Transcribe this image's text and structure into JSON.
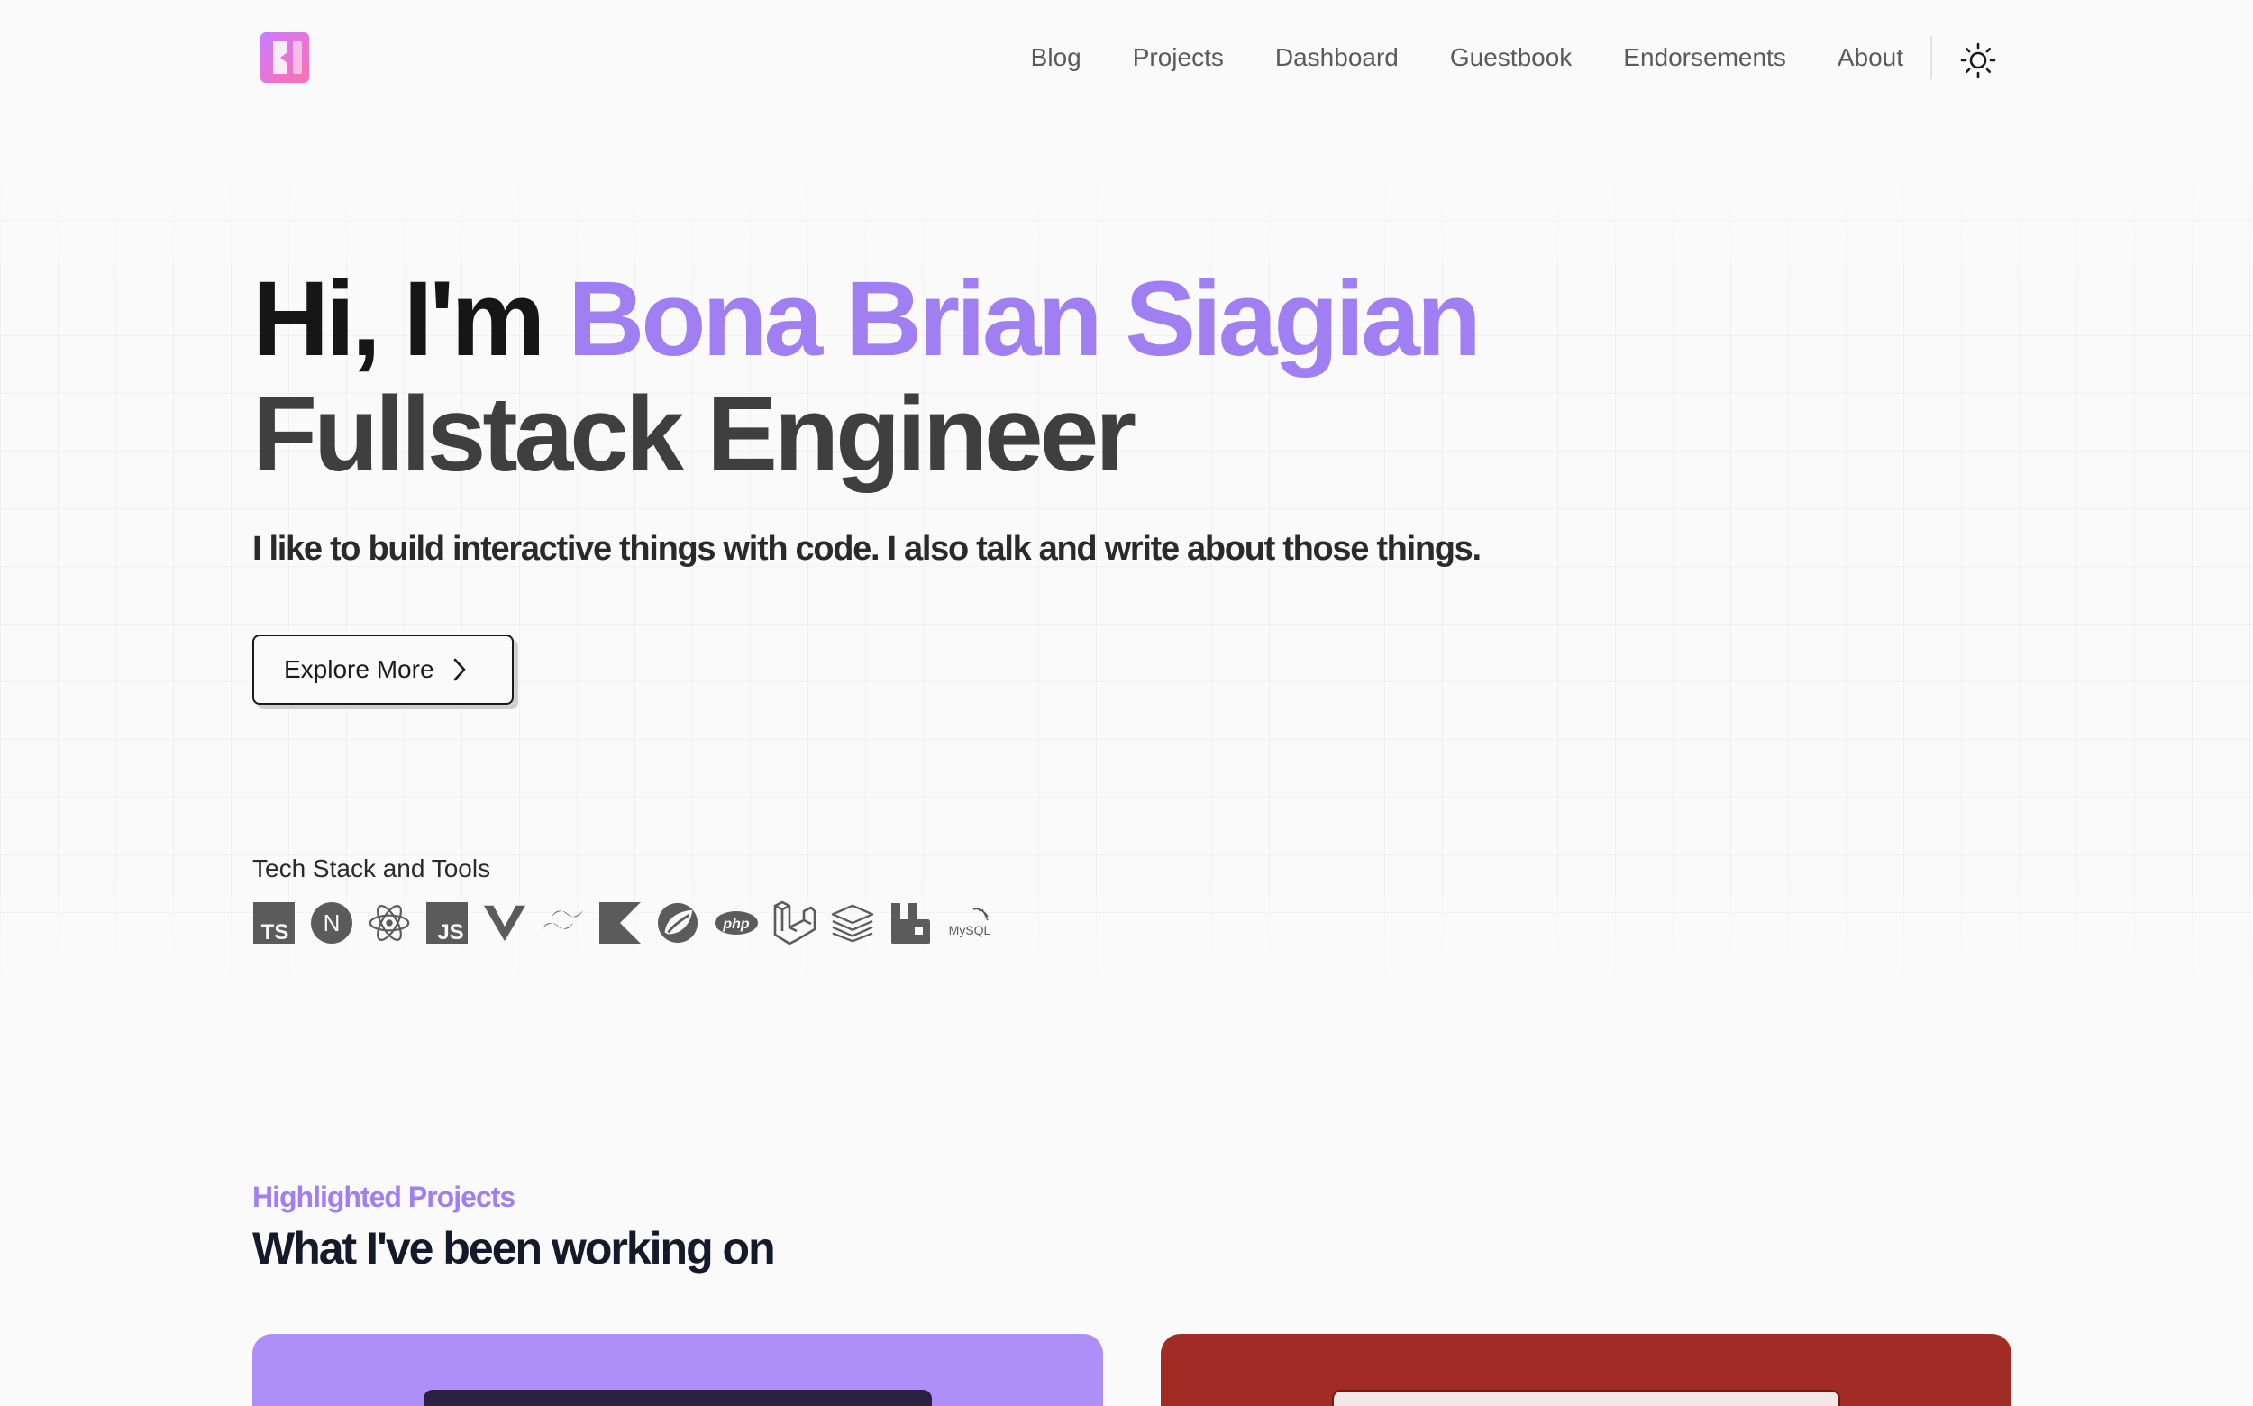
{
  "nav": {
    "items": [
      {
        "label": "Blog",
        "name": "nav-blog"
      },
      {
        "label": "Projects",
        "name": "nav-projects"
      },
      {
        "label": "Dashboard",
        "name": "nav-dashboard"
      },
      {
        "label": "Guestbook",
        "name": "nav-guestbook"
      },
      {
        "label": "Endorsements",
        "name": "nav-endorsements"
      },
      {
        "label": "About",
        "name": "nav-about"
      }
    ],
    "theme_icon": "sun-icon"
  },
  "hero": {
    "greeting": "Hi, I'm ",
    "name": "Bona Brian Siagian",
    "role": "Fullstack Engineer",
    "subtitle": "I like to build interactive things with code. I also talk and write about those things.",
    "cta_label": "Explore More"
  },
  "tech": {
    "label": "Tech Stack and Tools",
    "icons": [
      {
        "name": "typescript-icon",
        "text": "TS"
      },
      {
        "name": "nextjs-icon",
        "text": "N"
      },
      {
        "name": "react-icon",
        "text": ""
      },
      {
        "name": "javascript-icon",
        "text": "JS"
      },
      {
        "name": "vue-icon",
        "text": ""
      },
      {
        "name": "tailwind-icon",
        "text": ""
      },
      {
        "name": "kotlin-icon",
        "text": ""
      },
      {
        "name": "spring-icon",
        "text": ""
      },
      {
        "name": "php-icon",
        "text": "php"
      },
      {
        "name": "laravel-icon",
        "text": ""
      },
      {
        "name": "stack-icon",
        "text": ""
      },
      {
        "name": "rabbitmq-icon",
        "text": ""
      },
      {
        "name": "mysql-icon",
        "text": "MySQL"
      }
    ]
  },
  "projects": {
    "kicker": "Highlighted Projects",
    "title": "What I've been working on"
  },
  "colors": {
    "accent": "#a07ff3",
    "card_purple": "#ad8ff7",
    "card_red": "#a32b26",
    "background": "#fafafa"
  }
}
